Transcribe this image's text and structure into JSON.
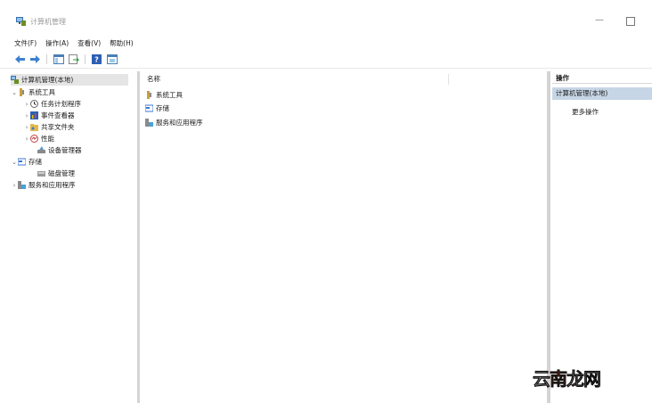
{
  "window": {
    "title": "计算机管理"
  },
  "menu": [
    "文件(F)",
    "操作(A)",
    "查看(V)",
    "帮助(H)"
  ],
  "toolbar": {
    "buttons": [
      "back-arrow-icon",
      "forward-arrow-icon",
      "show-hide-tree-icon",
      "export-list-icon",
      "help-icon",
      "properties-icon"
    ]
  },
  "tree": {
    "root": "计算机管理(本地)",
    "system_tools": "系统工具",
    "task_scheduler": "任务计划程序",
    "event_viewer": "事件查看器",
    "shared_folders": "共享文件夹",
    "performance": "性能",
    "device_manager": "设备管理器",
    "storage": "存储",
    "disk_management": "磁盘管理",
    "services_apps": "服务和应用程序"
  },
  "list": {
    "column_name": "名称",
    "items": [
      "系统工具",
      "存储",
      "服务和应用程序"
    ]
  },
  "actions": {
    "header": "操作",
    "section": "计算机管理(本地)",
    "more": "更多操作"
  },
  "watermark": {
    "part1": "云",
    "part2": "南",
    "part3": "龙网"
  },
  "colors": {
    "selection": "#e5e5e5",
    "action_section": "#c7d6e6",
    "watermark_red": "#e0401e"
  }
}
